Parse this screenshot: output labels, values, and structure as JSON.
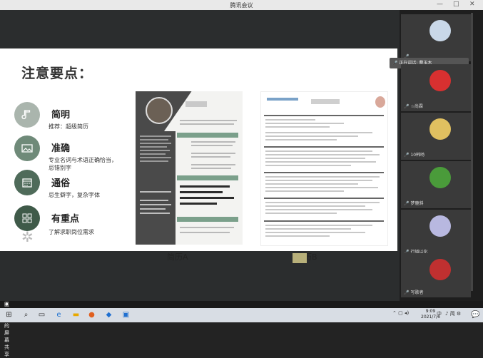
{
  "window": {
    "title": "腾讯会议",
    "minimize": "—",
    "maximize": "□",
    "close": "✕"
  },
  "slide": {
    "title": "注意要点：",
    "points": [
      {
        "title": "简明",
        "desc": "推荐：超级简历",
        "icon": "music-note-icon"
      },
      {
        "title": "准确",
        "desc": "专业名词与术语正确恰当，\n忌错别字",
        "icon": "image-icon"
      },
      {
        "title": "通俗",
        "desc": "忌生僻字，复杂字体",
        "icon": "calendar-icon"
      },
      {
        "title": "有重点",
        "desc": "了解求职岗位需求",
        "icon": "grid-icon"
      }
    ],
    "resume_a_caption": "简历A",
    "resume_b_caption": "简历B",
    "resume_a_sections": [
      "工作经历",
      "专业技能",
      "自身教育经历",
      "兴趣爱好"
    ],
    "colors": {
      "accent": "#5f7d6b",
      "dark": "#4a4a4a"
    }
  },
  "speaking": {
    "label": "正在讲话: 曹玉木"
  },
  "participants": [
    {
      "name": "",
      "avatar_color": "#c9d8e8"
    },
    {
      "name": "☆尚霖",
      "avatar_color": "#d83030"
    },
    {
      "name": "10韩旸",
      "avatar_color": "#e0c060"
    },
    {
      "name": "梦鹿斜",
      "avatar_color": "#4a9b3a"
    },
    {
      "name": "行钺以化",
      "avatar_color": "#b8b8e0"
    },
    {
      "name": "写歌者",
      "avatar_color": "#c03030"
    }
  ],
  "share_bar": {
    "text": "王泓又的屏幕共享"
  },
  "taskbar": {
    "time": "9:09",
    "date": "2021/7/6",
    "ime": "中",
    "tray_text": "♪ 简 ⚙"
  }
}
